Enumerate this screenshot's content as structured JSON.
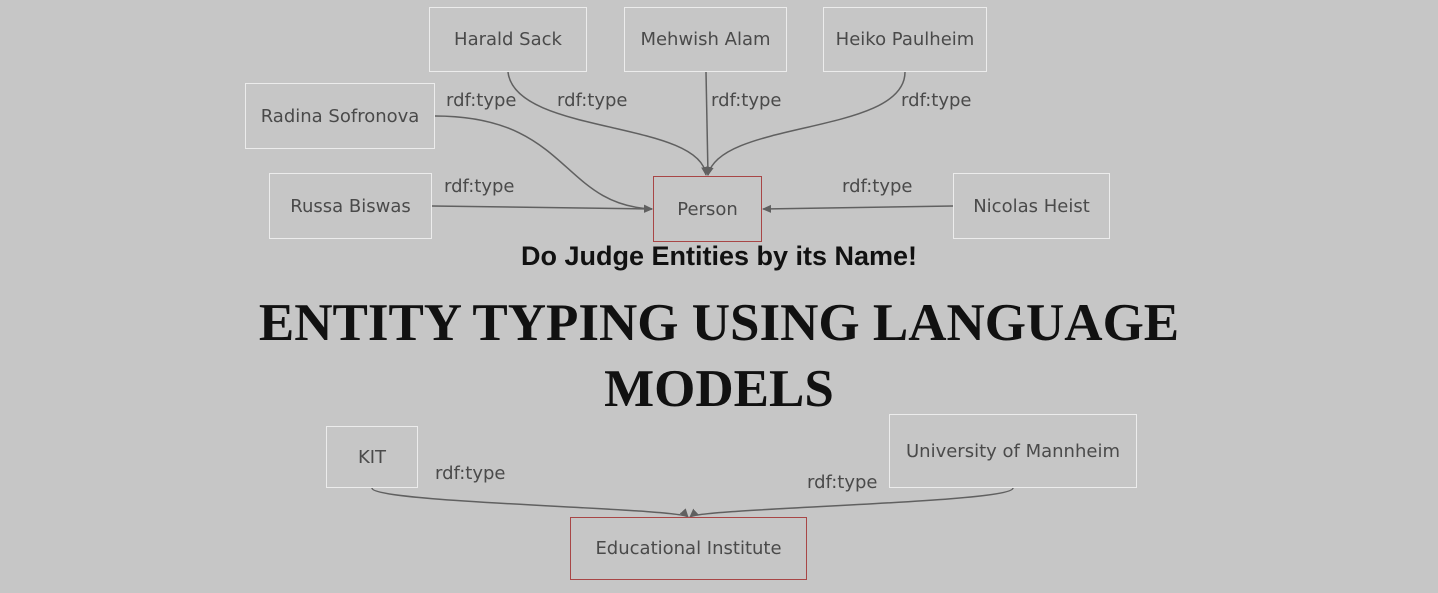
{
  "subtitle": "Do Judge Entities by its Name!",
  "title_line1": "ENTITY TYPING USING LANGUAGE",
  "title_line2": "MODELS",
  "colors": {
    "background": "#c6c6c6",
    "node_border": "#ececec",
    "target_border": "#a84646",
    "edge": "#606060",
    "text": "#4a4a4a"
  },
  "nodes": {
    "harald_sack": "Harald Sack",
    "mehwish_alam": "Mehwish Alam",
    "heiko_paulheim": "Heiko Paulheim",
    "radina_sofronova": "Radina Sofronova",
    "russa_biswas": "Russa Biswas",
    "nicolas_heist": "Nicolas Heist",
    "person": "Person",
    "kit": "KIT",
    "university_of_mannheim": "University of Mannheim",
    "educational_institute": "Educational Institute"
  },
  "edges": [
    {
      "from": "harald_sack",
      "to": "person",
      "label": "rdf:type"
    },
    {
      "from": "mehwish_alam",
      "to": "person",
      "label": "rdf:type"
    },
    {
      "from": "heiko_paulheim",
      "to": "person",
      "label": "rdf:type"
    },
    {
      "from": "radina_sofronova",
      "to": "person",
      "label": "rdf:type"
    },
    {
      "from": "russa_biswas",
      "to": "person",
      "label": "rdf:type"
    },
    {
      "from": "nicolas_heist",
      "to": "person",
      "label": "rdf:type"
    },
    {
      "from": "kit",
      "to": "educational_institute",
      "label": "rdf:type"
    },
    {
      "from": "university_of_mannheim",
      "to": "educational_institute",
      "label": "rdf:type"
    }
  ]
}
